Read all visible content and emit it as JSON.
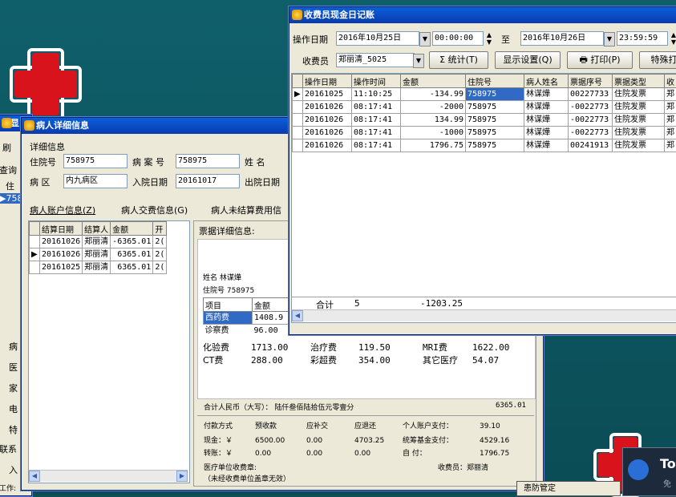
{
  "desktop": {
    "colors": {
      "bg": "#0e4f58",
      "title_bar": "#0a3bb0",
      "selection": "#316ac5"
    }
  },
  "bg_window": {
    "title_fragment": "显",
    "items": [
      "刷",
      "查询",
      "住",
      "▶",
      "758"
    ],
    "side_labels": [
      "病",
      "医",
      "家",
      "电",
      "特",
      "联系",
      "入"
    ],
    "bottom_label": "工作:"
  },
  "patient_window": {
    "title": "病人详细信息",
    "group_label": "详细信息",
    "fields": {
      "admission_no_label": "住院号",
      "admission_no": "758975",
      "case_no_label": "病 案 号",
      "case_no": "758975",
      "name_label": "姓    名",
      "ward_label": "病  区",
      "ward": "内九病区",
      "admit_date_label": "入院日期",
      "admit_date": "20161017",
      "discharge_date_label": "出院日期"
    },
    "tabs": [
      "病人账户信息(Z)",
      "病人交费信息(G)",
      "病人未结算费用信"
    ],
    "settle_table": {
      "headers": [
        "结算日期",
        "结算人",
        "金额",
        "开"
      ],
      "rows": [
        {
          "date": "20161026",
          "person": "郑丽清",
          "amount": "-6365.01",
          "extra": "2("
        },
        {
          "date": "20161026",
          "person": "郑丽清",
          "amount": "6365.01",
          "extra": "2("
        },
        {
          "date": "20161025",
          "person": "郑丽清",
          "amount": "6365.01",
          "extra": "2("
        }
      ]
    },
    "receipt": {
      "header": "票据详细信息:",
      "name_line": "姓名   林谋燁",
      "adm_line": "住院号  758975",
      "item_headers": [
        "项目",
        "金额"
      ],
      "items": [
        {
          "name": "西药费",
          "amount": "1408.9"
        },
        {
          "name": "诊察费",
          "amount": "96.00"
        },
        {
          "name": "化验费",
          "amount": "1713.00",
          "name2": "治疗费",
          "amount2": "119.50",
          "name3": "MRI费",
          "amount3": "1622.00"
        },
        {
          "name": "CT费",
          "amount": "288.00",
          "name2": "彩超费",
          "amount2": "354.00",
          "name3": "其它医疗",
          "amount3": "54.07"
        }
      ],
      "total_label": "合计人民币（大写）：  陆仟叁佰陆拾伍元零壹分",
      "total_amount": "6365.01",
      "pay_headers": [
        "付款方式",
        "预收款",
        "应补交",
        "应退还",
        "个人账户支付：",
        "39.10"
      ],
      "pay_row1": [
        "现金：￥",
        "6500.00",
        "0.00",
        "4703.25",
        "统筹基金支付：",
        "4529.16"
      ],
      "pay_row2": [
        "转账：￥",
        "0.00",
        "0.00",
        "0.00",
        "自        付：",
        "1796.75"
      ],
      "stamp_label": "医疗单位收费章:",
      "cashier_label": "收费员：郑丽清",
      "note": "（未经收费单位盖章无效）"
    }
  },
  "ledger_window": {
    "title": "收费员现金日记账",
    "op_date_label": "操作日期",
    "start_date": "2016年10月25日",
    "start_time": "00:00:00",
    "to_label": "至",
    "end_date": "2016年10月26日",
    "end_time": "23:59:59",
    "cashier_label": "收费员",
    "cashier": "郑丽清_5025",
    "stat_button": "Σ 统计(T)",
    "display_button": "显示设置(Q)",
    "print_button": "打印(P)",
    "special_button": "特殊打",
    "headers": [
      "操作日期",
      "操作时间",
      "金额",
      "住院号",
      "病人姓名",
      "票据序号",
      "票据类型",
      "收"
    ],
    "rows": [
      {
        "date": "20161025",
        "time": "11:10:25",
        "amount": "-134.99",
        "adm": "758975",
        "name": "林谋燁",
        "receipt": "00227733",
        "type": "住院发票",
        "c": "郑"
      },
      {
        "date": "20161026",
        "time": "08:17:41",
        "amount": "-2000",
        "adm": "758975",
        "name": "林谋燁",
        "receipt": "-0022773",
        "type": "住院发票",
        "c": "郑"
      },
      {
        "date": "20161026",
        "time": "08:17:41",
        "amount": "134.99",
        "adm": "758975",
        "name": "林谋燁",
        "receipt": "-0022773",
        "type": "住院发票",
        "c": "郑"
      },
      {
        "date": "20161026",
        "time": "08:17:41",
        "amount": "-1000",
        "adm": "758975",
        "name": "林谋燁",
        "receipt": "-0022773",
        "type": "住院发票",
        "c": "郑"
      },
      {
        "date": "20161026",
        "time": "08:17:41",
        "amount": "1796.75",
        "adm": "758975",
        "name": "林谋燁",
        "receipt": "00241913",
        "type": "住院发票",
        "c": "郑"
      }
    ],
    "total_label": "合计",
    "total_count": "5",
    "total_amount": "-1203.25"
  },
  "notifications": {
    "popup_title": "患防管定",
    "teamviewer": "To",
    "teamviewer_sub": "免"
  }
}
